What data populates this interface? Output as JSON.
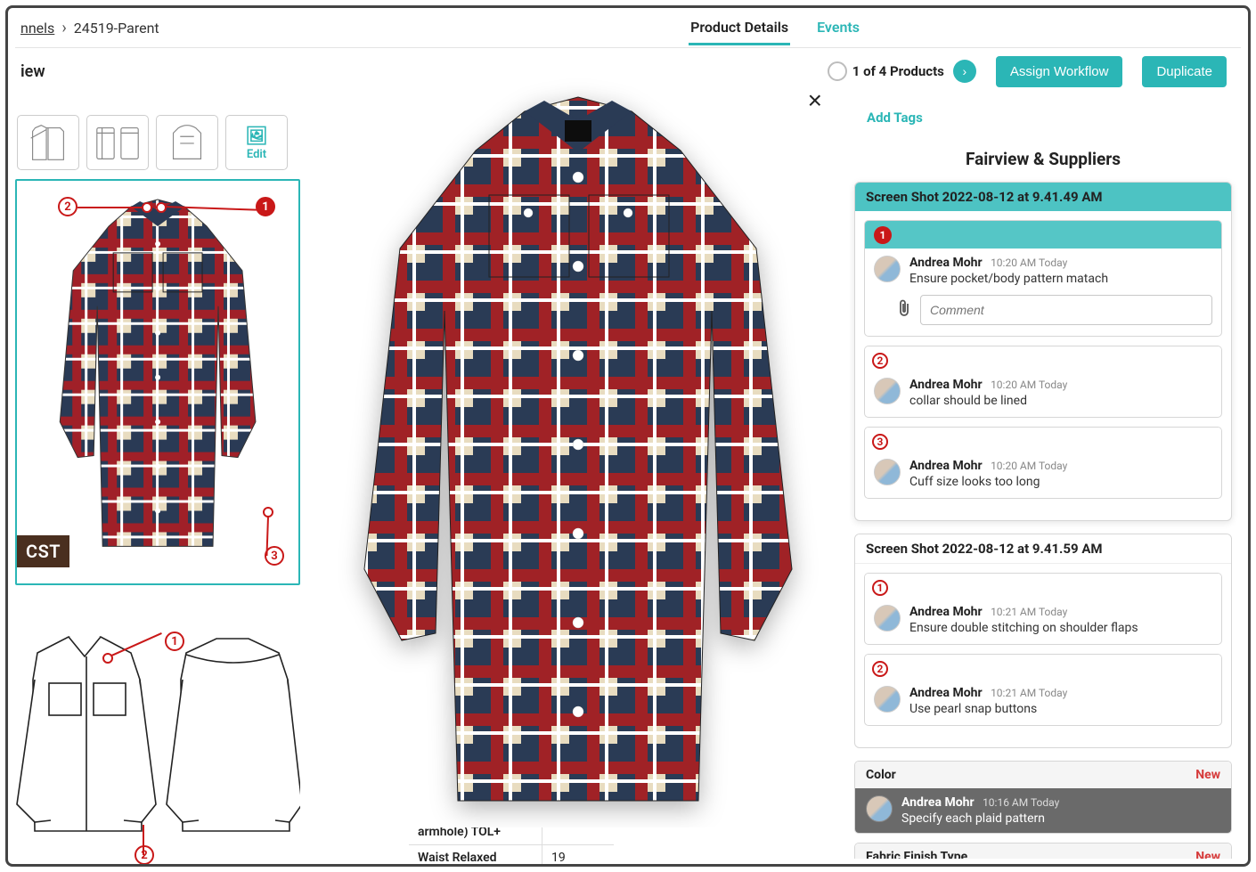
{
  "breadcrumb": {
    "prev": "nnels",
    "current": "24519-Parent"
  },
  "tabs": {
    "details": "Product Details",
    "events": "Events"
  },
  "view_label": "iew",
  "counter": {
    "text": "1 of 4 Products"
  },
  "buttons": {
    "assign": "Assign Workflow",
    "duplicate": "Duplicate",
    "edit": "Edit"
  },
  "cst_tag": "CST",
  "close_label": "×",
  "spec": {
    "row1_label": "armhole) TOL+",
    "row2_label": "Waist Relaxed",
    "row2_val": "19"
  },
  "right": {
    "add_tags": "Add Tags",
    "supplier_title": "Fairview & Suppliers",
    "card1": {
      "header": "Screen Shot 2022-08-12 at 9.41.49 AM",
      "notes": [
        {
          "pin": "1",
          "filled": true,
          "author": "Andrea Mohr",
          "time": "10:20 AM Today",
          "msg": "Ensure pocket/body pattern matach",
          "has_comment": true
        },
        {
          "pin": "2",
          "filled": false,
          "author": "Andrea Mohr",
          "time": "10:20 AM Today",
          "msg": "collar should be lined",
          "has_comment": false
        },
        {
          "pin": "3",
          "filled": false,
          "author": "Andrea Mohr",
          "time": "10:20 AM Today",
          "msg": "Cuff size looks too long",
          "has_comment": false
        }
      ],
      "comment_placeholder": "Comment"
    },
    "card2": {
      "header": "Screen Shot 2022-08-12 at 9.41.59 AM",
      "notes": [
        {
          "pin": "1",
          "author": "Andrea Mohr",
          "time": "10:21 AM Today",
          "msg": "Ensure double stitching on shoulder flaps"
        },
        {
          "pin": "2",
          "author": "Andrea Mohr",
          "time": "10:21 AM Today",
          "msg": "Use pearl snap buttons"
        }
      ]
    },
    "attr1": {
      "label": "Color",
      "badge": "New",
      "author": "Andrea Mohr",
      "time": "10:16 AM Today",
      "msg": "Specify each plaid pattern"
    },
    "attr2": {
      "label": "Fabric Finish Type",
      "badge": "New"
    }
  }
}
